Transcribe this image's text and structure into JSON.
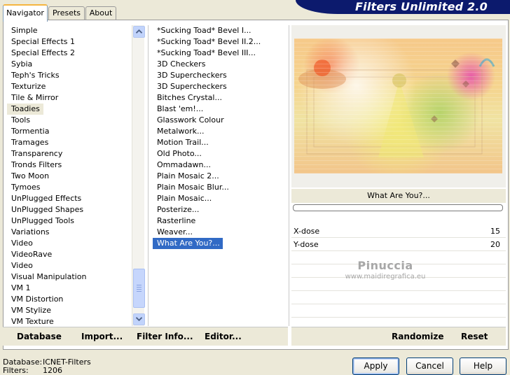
{
  "window": {
    "title": "Filters Unlimited 2.0"
  },
  "tabs": [
    {
      "label": "Navigator",
      "active": true
    },
    {
      "label": "Presets",
      "active": false
    },
    {
      "label": "About",
      "active": false
    }
  ],
  "categories": {
    "items": [
      "Simple",
      "Special Effects 1",
      "Special Effects 2",
      "Sybia",
      "Teph's Tricks",
      "Texturize",
      "Tile & Mirror",
      "Toadies",
      "Tools",
      "Tormentia",
      "Tramages",
      "Transparency",
      "Tronds Filters",
      "Two Moon",
      "Tymoes",
      "UnPlugged Effects",
      "UnPlugged Shapes",
      "UnPlugged Tools",
      "Variations",
      "Video",
      "VideoRave",
      "Video",
      "Visual Manipulation",
      "VM 1",
      "VM Distortion",
      "VM Stylize",
      "VM Texture"
    ],
    "selected": "Toadies"
  },
  "filters": {
    "items": [
      "*Sucking Toad*  Bevel I...",
      "*Sucking Toad*  Bevel II.2...",
      "*Sucking Toad*  Bevel III...",
      "3D Checkers",
      "3D Supercheckers",
      "3D Supercheckers",
      "Bitches Crystal...",
      "Blast 'em!...",
      "Glasswork Colour",
      "Metalwork...",
      "Motion Trail...",
      "Old Photo...",
      "Ommadawn...",
      "Plain Mosaic 2...",
      "Plain Mosaic Blur...",
      "Plain Mosaic...",
      "Posterize...",
      "Rasterline",
      "Weaver...",
      "What Are You?..."
    ],
    "selected": "What Are You?..."
  },
  "params": {
    "title": "What Are You?...",
    "rows": [
      {
        "label": "X-dose",
        "value": "15"
      },
      {
        "label": "Y-dose",
        "value": "20"
      }
    ]
  },
  "watermark": {
    "line1": "Pinuccia",
    "line2": "www.maidiregrafica.eu"
  },
  "toolbar_left": {
    "database": "Database",
    "import": "Import...",
    "filter_info": "Filter Info...",
    "editor": "Editor..."
  },
  "toolbar_right": {
    "randomize": "Randomize",
    "reset": "Reset"
  },
  "status": {
    "database_label": "Database:",
    "database_value": "ICNET-Filters",
    "filters_label": "Filters:",
    "filters_value": "1206"
  },
  "buttons": {
    "apply": "Apply",
    "cancel": "Cancel",
    "help": "Help"
  }
}
